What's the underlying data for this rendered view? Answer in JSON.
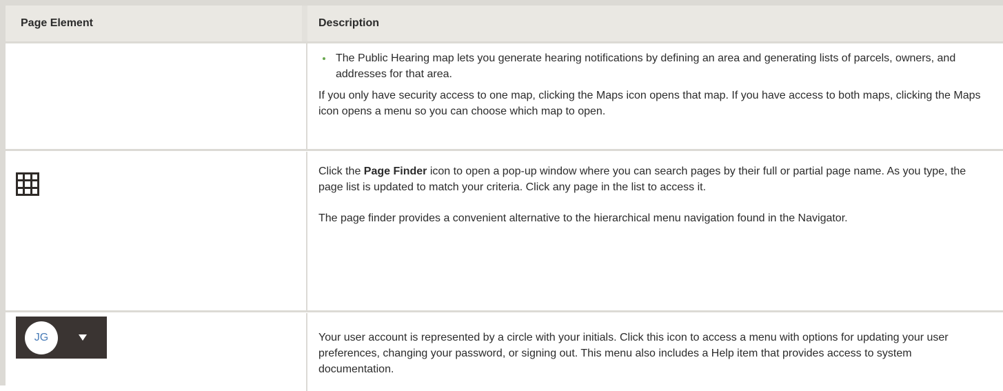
{
  "table": {
    "headers": [
      "Page Element",
      "Description"
    ],
    "rows": [
      {
        "bullet": "The Public Hearing map lets you generate hearing notifications by defining an area and generating lists of parcels, owners, and addresses for that area.",
        "paragraph": "If you only have security access to one map, clicking the Maps icon opens that map. If you have access to both maps, clicking the Maps icon opens a menu so you can choose which map to open."
      },
      {
        "icon": "grid-icon",
        "p1_prefix": "Click the ",
        "p1_bold": "Page Finder",
        "p1_suffix": " icon to open a pop-up window where you can search pages by their full or partial page name. As you type, the page list is updated to match your criteria. Click any page in the list to access it.",
        "p2": "The page finder provides a convenient alternative to the hierarchical menu navigation found in the Navigator."
      },
      {
        "icon": "user-avatar-icon",
        "avatar_initials": "JG",
        "paragraph": "Your user account is represented by a circle with your initials. Click this icon to access a menu with options for updating your user preferences, changing your password, or signing out. This menu also includes a Help item that provides access to system documentation."
      }
    ]
  }
}
